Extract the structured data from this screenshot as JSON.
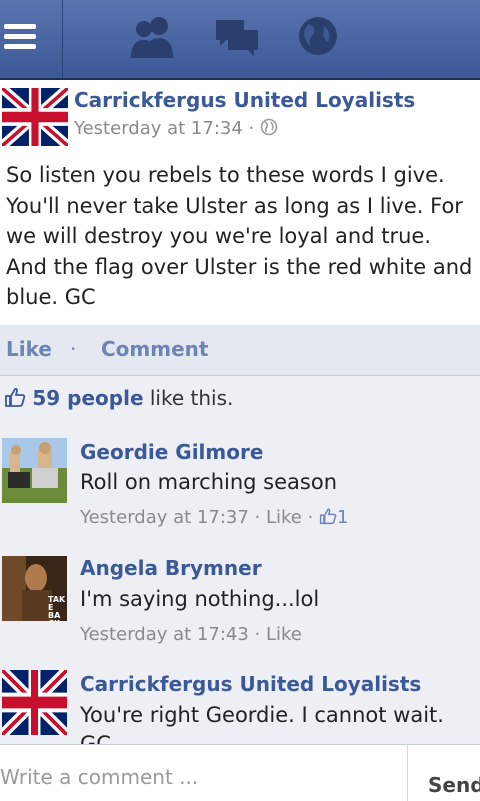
{
  "topbar": {
    "icons": [
      "menu-icon",
      "friend-requests-icon",
      "messages-icon",
      "notifications-globe-icon"
    ],
    "colors": {
      "bar": "#3b5998",
      "icon_inactive": "#2a3f6e"
    }
  },
  "post": {
    "author": "Carrickfergus United Loyalists",
    "time": "Yesterday at 17:34 ·",
    "privacy_icon": "globe-icon",
    "text": "So listen you rebels to these words I give. You'll never take Ulster as long as I live. For we will destroy you we're loyal and true. And the flag over Ulster is the red white and blue. GC"
  },
  "actions": {
    "like": "Like",
    "separator": "·",
    "comment": "Comment"
  },
  "likes": {
    "count_text": "59 people",
    "suffix": " like this."
  },
  "comments": [
    {
      "name": "Geordie Gilmore",
      "text": "Roll on marching season",
      "time": "Yesterday at 17:37 · ",
      "like_link": "Like",
      "sep": " · ",
      "like_count": "1"
    },
    {
      "name": "Angela Brymner",
      "text": "I'm saying nothing...lol",
      "time": "Yesterday at 17:43 · ",
      "like_link": "Like",
      "avatar_caption": "TAKE BACK THE"
    },
    {
      "name": "Carrickfergus United Loyalists",
      "text": "You're right Geordie. I cannot wait.",
      "text_cont": "GC"
    }
  ],
  "composer": {
    "placeholder": "Write a comment ...",
    "send": "Send"
  }
}
